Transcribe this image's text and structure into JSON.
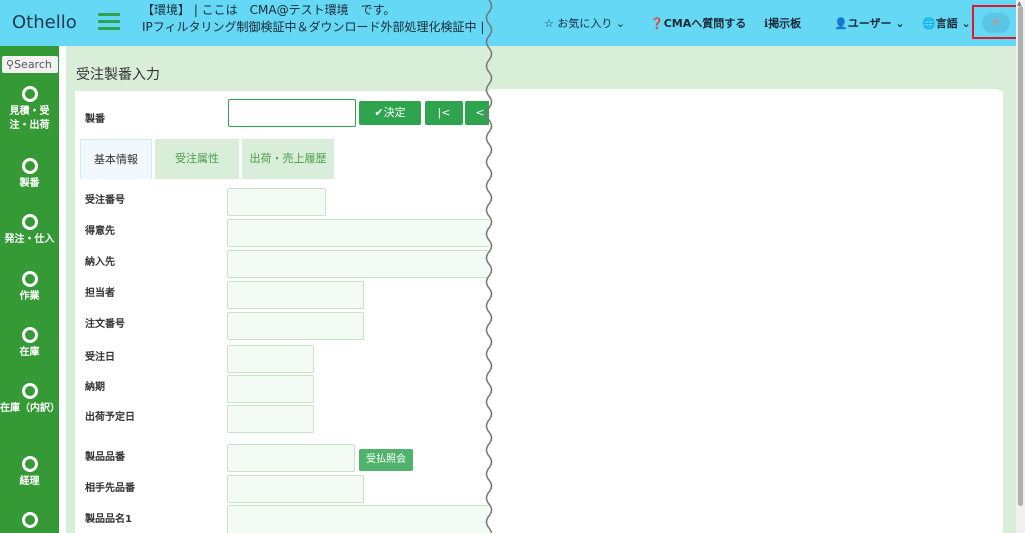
{
  "header": {
    "logo": "Othello",
    "env_line1": "【環境】 | ここは　CMA@テスト環境　です。",
    "env_line2": "IPフィルタリング制御検証中＆ダウンロード外部処理化検証中 | 不審",
    "favorites": "☆ お気に入り",
    "question": "CMAへ質問する",
    "board": "掲示板",
    "user": "ユーザー",
    "language": "言語",
    "star": "★"
  },
  "sidebar": {
    "search": "Search",
    "items": [
      {
        "label": "見積・受注・出荷"
      },
      {
        "label": "製番"
      },
      {
        "label": "発注・仕入"
      },
      {
        "label": "作業"
      },
      {
        "label": "在庫"
      },
      {
        "label": "在庫（内訳）"
      },
      {
        "label": "経理"
      }
    ]
  },
  "main": {
    "title": "受注製番入力",
    "seiban_label": "製番",
    "ok_button": "✔決定",
    "first_button": "|<",
    "prev_button": "<",
    "tabs": [
      "基本情報",
      "受注属性",
      "出荷・売上履歴"
    ],
    "fields": [
      "受注番号",
      "得意先",
      "納入先",
      "担当者",
      "注文番号",
      "受注日",
      "納期",
      "出荷予定日",
      "製品品番",
      "相手先品番",
      "製品品名1"
    ],
    "inquiry_button": "受払照会"
  }
}
